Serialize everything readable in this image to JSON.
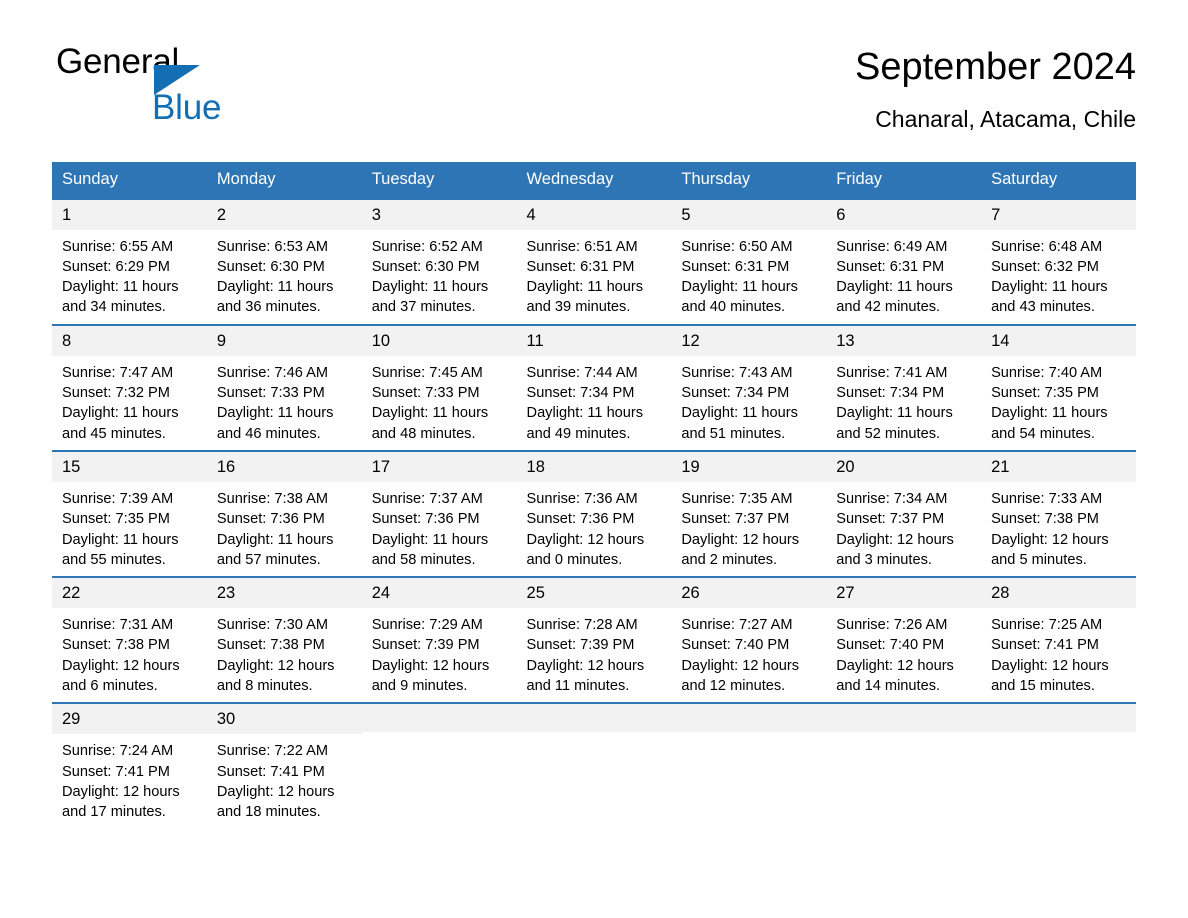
{
  "logo": {
    "word_one": "General",
    "word_two": "Blue",
    "triangle_color": "#146eb4"
  },
  "header": {
    "title": "September 2024",
    "subtitle": "Chanaral, Atacama, Chile"
  },
  "theme": {
    "header_blue": "#2e75b6",
    "daynum_band": "#f2f2f2",
    "text": "#000000",
    "page_background": "#ffffff"
  },
  "calendar": {
    "weekdays": [
      "Sunday",
      "Monday",
      "Tuesday",
      "Wednesday",
      "Thursday",
      "Friday",
      "Saturday"
    ],
    "weeks": [
      [
        {
          "day": "1",
          "sunrise": "Sunrise: 6:55 AM",
          "sunset": "Sunset: 6:29 PM",
          "daylight_line1": "Daylight: 11 hours",
          "daylight_line2": "and 34 minutes."
        },
        {
          "day": "2",
          "sunrise": "Sunrise: 6:53 AM",
          "sunset": "Sunset: 6:30 PM",
          "daylight_line1": "Daylight: 11 hours",
          "daylight_line2": "and 36 minutes."
        },
        {
          "day": "3",
          "sunrise": "Sunrise: 6:52 AM",
          "sunset": "Sunset: 6:30 PM",
          "daylight_line1": "Daylight: 11 hours",
          "daylight_line2": "and 37 minutes."
        },
        {
          "day": "4",
          "sunrise": "Sunrise: 6:51 AM",
          "sunset": "Sunset: 6:31 PM",
          "daylight_line1": "Daylight: 11 hours",
          "daylight_line2": "and 39 minutes."
        },
        {
          "day": "5",
          "sunrise": "Sunrise: 6:50 AM",
          "sunset": "Sunset: 6:31 PM",
          "daylight_line1": "Daylight: 11 hours",
          "daylight_line2": "and 40 minutes."
        },
        {
          "day": "6",
          "sunrise": "Sunrise: 6:49 AM",
          "sunset": "Sunset: 6:31 PM",
          "daylight_line1": "Daylight: 11 hours",
          "daylight_line2": "and 42 minutes."
        },
        {
          "day": "7",
          "sunrise": "Sunrise: 6:48 AM",
          "sunset": "Sunset: 6:32 PM",
          "daylight_line1": "Daylight: 11 hours",
          "daylight_line2": "and 43 minutes."
        }
      ],
      [
        {
          "day": "8",
          "sunrise": "Sunrise: 7:47 AM",
          "sunset": "Sunset: 7:32 PM",
          "daylight_line1": "Daylight: 11 hours",
          "daylight_line2": "and 45 minutes."
        },
        {
          "day": "9",
          "sunrise": "Sunrise: 7:46 AM",
          "sunset": "Sunset: 7:33 PM",
          "daylight_line1": "Daylight: 11 hours",
          "daylight_line2": "and 46 minutes."
        },
        {
          "day": "10",
          "sunrise": "Sunrise: 7:45 AM",
          "sunset": "Sunset: 7:33 PM",
          "daylight_line1": "Daylight: 11 hours",
          "daylight_line2": "and 48 minutes."
        },
        {
          "day": "11",
          "sunrise": "Sunrise: 7:44 AM",
          "sunset": "Sunset: 7:34 PM",
          "daylight_line1": "Daylight: 11 hours",
          "daylight_line2": "and 49 minutes."
        },
        {
          "day": "12",
          "sunrise": "Sunrise: 7:43 AM",
          "sunset": "Sunset: 7:34 PM",
          "daylight_line1": "Daylight: 11 hours",
          "daylight_line2": "and 51 minutes."
        },
        {
          "day": "13",
          "sunrise": "Sunrise: 7:41 AM",
          "sunset": "Sunset: 7:34 PM",
          "daylight_line1": "Daylight: 11 hours",
          "daylight_line2": "and 52 minutes."
        },
        {
          "day": "14",
          "sunrise": "Sunrise: 7:40 AM",
          "sunset": "Sunset: 7:35 PM",
          "daylight_line1": "Daylight: 11 hours",
          "daylight_line2": "and 54 minutes."
        }
      ],
      [
        {
          "day": "15",
          "sunrise": "Sunrise: 7:39 AM",
          "sunset": "Sunset: 7:35 PM",
          "daylight_line1": "Daylight: 11 hours",
          "daylight_line2": "and 55 minutes."
        },
        {
          "day": "16",
          "sunrise": "Sunrise: 7:38 AM",
          "sunset": "Sunset: 7:36 PM",
          "daylight_line1": "Daylight: 11 hours",
          "daylight_line2": "and 57 minutes."
        },
        {
          "day": "17",
          "sunrise": "Sunrise: 7:37 AM",
          "sunset": "Sunset: 7:36 PM",
          "daylight_line1": "Daylight: 11 hours",
          "daylight_line2": "and 58 minutes."
        },
        {
          "day": "18",
          "sunrise": "Sunrise: 7:36 AM",
          "sunset": "Sunset: 7:36 PM",
          "daylight_line1": "Daylight: 12 hours",
          "daylight_line2": "and 0 minutes."
        },
        {
          "day": "19",
          "sunrise": "Sunrise: 7:35 AM",
          "sunset": "Sunset: 7:37 PM",
          "daylight_line1": "Daylight: 12 hours",
          "daylight_line2": "and 2 minutes."
        },
        {
          "day": "20",
          "sunrise": "Sunrise: 7:34 AM",
          "sunset": "Sunset: 7:37 PM",
          "daylight_line1": "Daylight: 12 hours",
          "daylight_line2": "and 3 minutes."
        },
        {
          "day": "21",
          "sunrise": "Sunrise: 7:33 AM",
          "sunset": "Sunset: 7:38 PM",
          "daylight_line1": "Daylight: 12 hours",
          "daylight_line2": "and 5 minutes."
        }
      ],
      [
        {
          "day": "22",
          "sunrise": "Sunrise: 7:31 AM",
          "sunset": "Sunset: 7:38 PM",
          "daylight_line1": "Daylight: 12 hours",
          "daylight_line2": "and 6 minutes."
        },
        {
          "day": "23",
          "sunrise": "Sunrise: 7:30 AM",
          "sunset": "Sunset: 7:38 PM",
          "daylight_line1": "Daylight: 12 hours",
          "daylight_line2": "and 8 minutes."
        },
        {
          "day": "24",
          "sunrise": "Sunrise: 7:29 AM",
          "sunset": "Sunset: 7:39 PM",
          "daylight_line1": "Daylight: 12 hours",
          "daylight_line2": "and 9 minutes."
        },
        {
          "day": "25",
          "sunrise": "Sunrise: 7:28 AM",
          "sunset": "Sunset: 7:39 PM",
          "daylight_line1": "Daylight: 12 hours",
          "daylight_line2": "and 11 minutes."
        },
        {
          "day": "26",
          "sunrise": "Sunrise: 7:27 AM",
          "sunset": "Sunset: 7:40 PM",
          "daylight_line1": "Daylight: 12 hours",
          "daylight_line2": "and 12 minutes."
        },
        {
          "day": "27",
          "sunrise": "Sunrise: 7:26 AM",
          "sunset": "Sunset: 7:40 PM",
          "daylight_line1": "Daylight: 12 hours",
          "daylight_line2": "and 14 minutes."
        },
        {
          "day": "28",
          "sunrise": "Sunrise: 7:25 AM",
          "sunset": "Sunset: 7:41 PM",
          "daylight_line1": "Daylight: 12 hours",
          "daylight_line2": "and 15 minutes."
        }
      ],
      [
        {
          "day": "29",
          "sunrise": "Sunrise: 7:24 AM",
          "sunset": "Sunset: 7:41 PM",
          "daylight_line1": "Daylight: 12 hours",
          "daylight_line2": "and 17 minutes."
        },
        {
          "day": "30",
          "sunrise": "Sunrise: 7:22 AM",
          "sunset": "Sunset: 7:41 PM",
          "daylight_line1": "Daylight: 12 hours",
          "daylight_line2": "and 18 minutes."
        },
        {
          "day": "",
          "sunrise": "",
          "sunset": "",
          "daylight_line1": "",
          "daylight_line2": ""
        },
        {
          "day": "",
          "sunrise": "",
          "sunset": "",
          "daylight_line1": "",
          "daylight_line2": ""
        },
        {
          "day": "",
          "sunrise": "",
          "sunset": "",
          "daylight_line1": "",
          "daylight_line2": ""
        },
        {
          "day": "",
          "sunrise": "",
          "sunset": "",
          "daylight_line1": "",
          "daylight_line2": ""
        },
        {
          "day": "",
          "sunrise": "",
          "sunset": "",
          "daylight_line1": "",
          "daylight_line2": ""
        }
      ]
    ]
  }
}
